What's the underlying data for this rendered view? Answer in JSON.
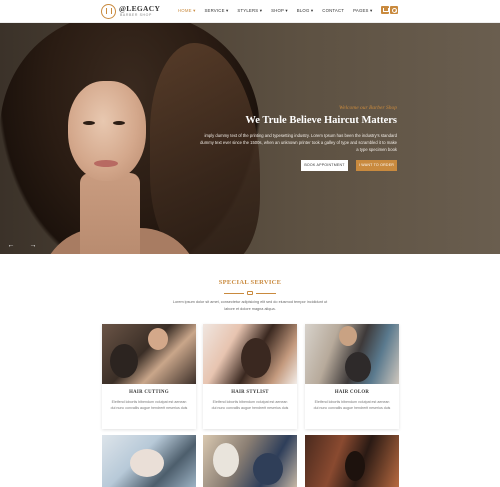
{
  "brand": {
    "name": "@LEGACY",
    "tagline": "BARBER SHOP"
  },
  "nav": {
    "items": [
      {
        "label": "HOME ▾",
        "active": true
      },
      {
        "label": "SERVICE ▾",
        "active": false
      },
      {
        "label": "STYLERS ▾",
        "active": false
      },
      {
        "label": "SHOP ▾",
        "active": false
      },
      {
        "label": "BLOG ▾",
        "active": false
      },
      {
        "label": "CONTACT",
        "active": false
      },
      {
        "label": "PAGES ▾",
        "active": false
      }
    ],
    "icons": [
      "cart-icon",
      "search-icon"
    ]
  },
  "hero": {
    "subtitle": "Welcome our Barber Shop",
    "title": "We Trule Believe Haircut Matters",
    "text": "imply dummy text of the printing and typesetting industry. Lorem Ipsum has been the industry's standard dummy text ever since the 1500s, when an unknown printer took a galley of type and scrambled it to make a type specimen book",
    "buttons": {
      "appointment": "BOOK APPOINTMENT",
      "order": "I WANT TO ORDER"
    },
    "arrows": {
      "prev": "←",
      "next": "→"
    }
  },
  "services": {
    "title": "SPECIAL SERVICE",
    "description": "Lorem ipsum dolor sit amet, consectetur adipisicing elit sed do eiusmod tempor incididunt ut labore et dolore magna aliqua.",
    "cards": [
      {
        "title": "HAIR CUTTING",
        "text": "Eleifend lobortis bibendum volutpat est aenean dui nunc convallis augue hendrerit neserius duis"
      },
      {
        "title": "HAIR STYLIST",
        "text": "Eleifend lobortis bibendum volutpat est aenean dui nunc convallis augue hendrerit neserius duis"
      },
      {
        "title": "HAIR COLOR",
        "text": "Eleifend lobortis bibendum volutpat est aenean dui nunc convallis augue hendrerit neserius duis"
      }
    ]
  },
  "colors": {
    "accent": "#c98a3e",
    "hero_bg": "#4d4236",
    "text": "#333333"
  }
}
